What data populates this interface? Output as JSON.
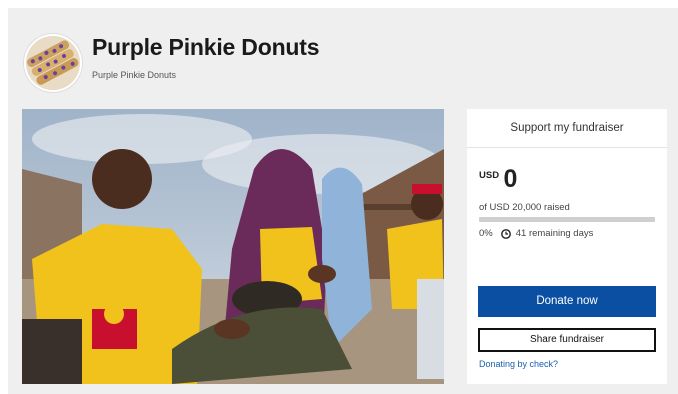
{
  "header": {
    "title": "Purple Pinkie Donuts",
    "subtitle": "Purple Pinkie Donuts"
  },
  "fundraiser": {
    "card_title": "Support my fundraiser",
    "currency": "USD",
    "amount_raised": "0",
    "goal_text": "of USD 20,000 raised",
    "progress_percent": 0,
    "percent_label": "0%",
    "days_label": "41 remaining days",
    "donate_label": "Donate now",
    "share_label": "Share fundraiser",
    "check_link": "Donating by check?"
  },
  "colors": {
    "accent": "#0b4fa3",
    "progress_track": "#cfcfcf",
    "link": "#1b5fb0"
  },
  "icons": {
    "clock": "clock-icon"
  }
}
